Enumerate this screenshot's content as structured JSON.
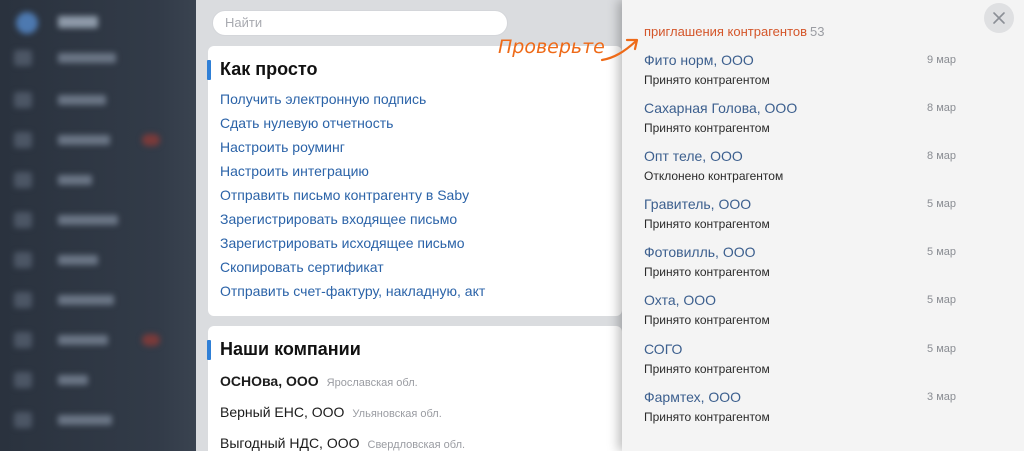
{
  "search": {
    "placeholder": "Найти"
  },
  "easy": {
    "title": "Как просто",
    "links": [
      "Получить электронную подпись",
      "Сдать нулевую отчетность",
      "Настроить роуминг",
      "Настроить интеграцию",
      "Отправить письмо контрагенту в Saby",
      "Зарегистрировать входящее письмо",
      "Зарегистрировать исходящее письмо",
      "Скопировать сертификат",
      "Отправить счет-фактуру, накладную, акт"
    ]
  },
  "companies": {
    "title": "Наши компании",
    "items": [
      {
        "name": "ОСНОва, ООО",
        "region": "Ярославская обл."
      },
      {
        "name": "Верный ЕНС, ООО",
        "region": "Ульяновская обл."
      },
      {
        "name": "Выгодный НДС, ООО",
        "region": "Свердловская обл."
      }
    ]
  },
  "panel": {
    "title": "приглашения контрагентов",
    "count": "53",
    "items": [
      {
        "name": "Фито норм, ООО",
        "status": "Принято контрагентом",
        "date": "9 мар"
      },
      {
        "name": "Сахарная Голова, ООО",
        "status": "Принято контрагентом",
        "date": "8 мар"
      },
      {
        "name": "Опт теле, ООО",
        "status": "Отклонено контрагентом",
        "date": "8 мар"
      },
      {
        "name": "Гравитель, ООО",
        "status": "Принято контрагентом",
        "date": "5 мар"
      },
      {
        "name": "Фотовилль, ООО",
        "status": "Принято контрагентом",
        "date": "5 мар"
      },
      {
        "name": "Охта, ООО",
        "status": "Принято контрагентом",
        "date": "5 мар"
      },
      {
        "name": "СОГО",
        "status": "Принято контрагентом",
        "date": "5 мар"
      },
      {
        "name": "Фармтех, ООО",
        "status": "Принято контрагентом",
        "date": "3 мар"
      }
    ]
  },
  "annotation": {
    "text": "Проверьте"
  },
  "colors": {
    "accent": "#2f7fd6",
    "link": "#2b63a8",
    "panel_title": "#d4562a",
    "annotation": "#ee6a18",
    "sidebar": "#2a323e"
  },
  "icons": {
    "close": "close-icon",
    "arrow": "arrow-icon"
  }
}
